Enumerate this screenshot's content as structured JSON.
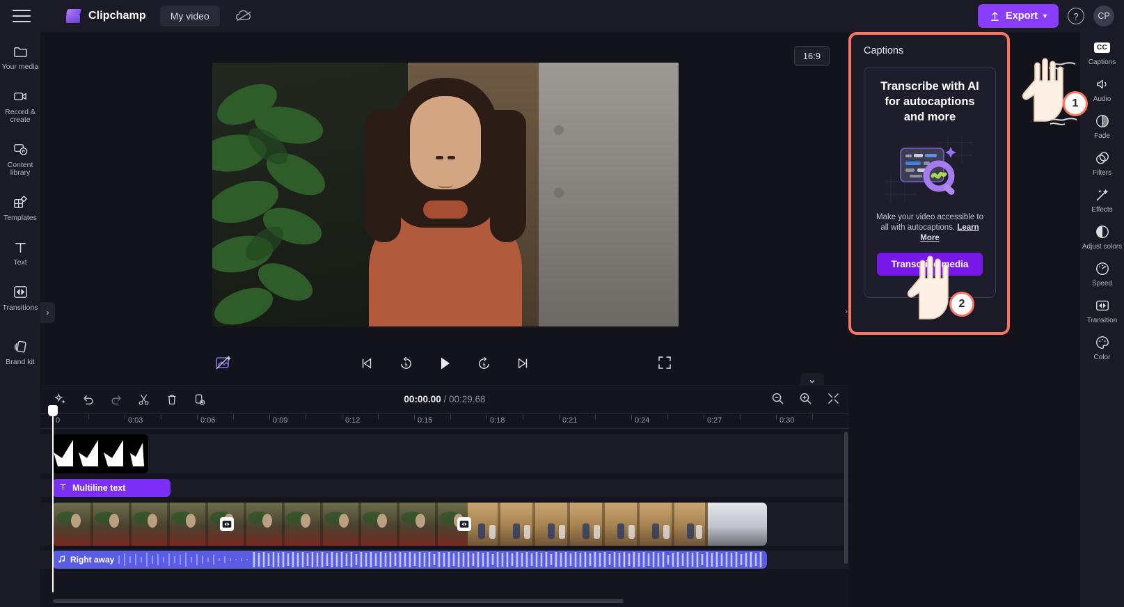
{
  "app": {
    "brand": "Clipchamp",
    "project_name": "My video",
    "menu_icon": "hamburger-icon",
    "cloud_icon": "cloud-off-icon"
  },
  "topbar": {
    "export_label": "Export",
    "export_chevron": "⌄",
    "export_color": "#8b3dff",
    "help_label": "?",
    "avatar_initials": "CP"
  },
  "sidebar": {
    "items": [
      {
        "label": "Your media",
        "icon": "folder-icon"
      },
      {
        "label": "Record & create",
        "icon": "video-camera-icon"
      },
      {
        "label": "Content library",
        "icon": "content-library-icon"
      },
      {
        "label": "Templates",
        "icon": "templates-icon"
      },
      {
        "label": "Text",
        "icon": "text-t-icon"
      },
      {
        "label": "Transitions",
        "icon": "transitions-icon"
      },
      {
        "label": "Brand kit",
        "icon": "brand-kit-icon"
      }
    ],
    "collapse_icon": "›"
  },
  "preview": {
    "aspect_ratio": "16:9",
    "magic_icon": "magic-remove-background-icon",
    "fullscreen_icon": "fullscreen-icon",
    "controls": [
      {
        "name": "skip-to-start-button",
        "icon": "skip-back-icon"
      },
      {
        "name": "rewind-5-button",
        "icon": "rewind-5-icon",
        "label": "5"
      },
      {
        "name": "play-button",
        "icon": "play-icon"
      },
      {
        "name": "forward-5-button",
        "icon": "forward-5-icon",
        "label": "5"
      },
      {
        "name": "skip-to-end-button",
        "icon": "skip-forward-icon"
      }
    ]
  },
  "captions_panel": {
    "title": "Captions",
    "card_heading": "Transcribe with AI for autocaptions and more",
    "card_body_prefix": "Make your video accessible to all with autocaptions. ",
    "card_body_link": "Learn More",
    "button_label": "Transcribe media",
    "button_color": "#7717e8",
    "highlight_color": "#fd7561",
    "collapse_icon": "›"
  },
  "right_rail": {
    "items": [
      {
        "label": "Captions",
        "icon": "cc-icon",
        "badge": "CC"
      },
      {
        "label": "Audio",
        "icon": "audio-icon"
      },
      {
        "label": "Fade",
        "icon": "fade-icon"
      },
      {
        "label": "Filters",
        "icon": "filters-icon"
      },
      {
        "label": "Effects",
        "icon": "effects-wand-icon"
      },
      {
        "label": "Adjust colors",
        "icon": "adjust-colors-icon"
      },
      {
        "label": "Speed",
        "icon": "speed-gauge-icon"
      },
      {
        "label": "Transition",
        "icon": "transition-icon"
      },
      {
        "label": "Color",
        "icon": "color-palette-icon"
      }
    ]
  },
  "timeline": {
    "tools": [
      {
        "name": "ai-tools-button",
        "icon": "sparkle-icon"
      },
      {
        "name": "undo-button",
        "icon": "undo-icon"
      },
      {
        "name": "redo-button",
        "icon": "redo-icon"
      },
      {
        "name": "split-button",
        "icon": "scissors-icon"
      },
      {
        "name": "delete-button",
        "icon": "trash-icon"
      },
      {
        "name": "duplicate-button",
        "icon": "duplicate-icon"
      }
    ],
    "current_time": "00:00.00",
    "separator": "/",
    "total_time": "00:29.68",
    "zoom_out_icon": "zoom-out-icon",
    "zoom_in_icon": "zoom-in-icon",
    "fit_icon": "fit-to-screen-icon",
    "collapse_icon": "⌄",
    "ruler_labels": [
      "0",
      "0:03",
      "0:06",
      "0:09",
      "0:12",
      "0:15",
      "0:18",
      "0:21",
      "0:24",
      "0:27",
      "0:30"
    ],
    "clips": {
      "sticker_label": "",
      "text_label": "Multiline text",
      "text_icon": "text-t-icon",
      "audio_label": "Right away",
      "audio_icon": "music-note-icon",
      "transition_icon": "transition-icon"
    }
  },
  "annotations": {
    "step_one": "1",
    "step_two": "2"
  }
}
